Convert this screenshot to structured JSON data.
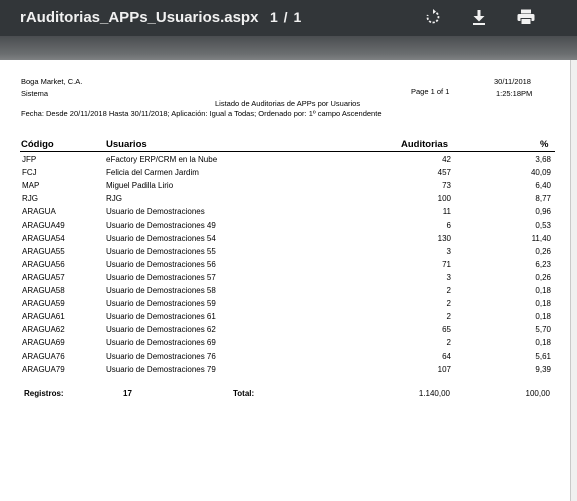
{
  "toolbar": {
    "title": "rAuditorias_APPs_Usuarios.aspx",
    "page_count": "1 / 1",
    "rotate_icon": "rotate-icon",
    "download_icon": "download-icon",
    "print_icon": "print-icon"
  },
  "report": {
    "company": "Boga Market, C.A.",
    "system": "Sistema",
    "page_label": "Page 1 of 1",
    "date": "30/11/2018",
    "time": "1:25:18PM",
    "title": "Listado de Auditorias de APPs por Usuarios",
    "filters": "Fecha: Desde 20/11/2018  Hasta 30/11/2018; Aplicación: Igual a Todas; Ordenado por: 1º campo Ascendente",
    "columns": {
      "code": "Código",
      "user": "Usuarios",
      "audits": "Auditorias",
      "pct": "%"
    },
    "rows": [
      {
        "code": "JFP",
        "user": "eFactory ERP/CRM en la Nube",
        "audits": "42",
        "pct": "3,68"
      },
      {
        "code": "FCJ",
        "user": "Felicia del Carmen Jardim",
        "audits": "457",
        "pct": "40,09"
      },
      {
        "code": "MAP",
        "user": "Miguel Padilla Lirio",
        "audits": "73",
        "pct": "6,40"
      },
      {
        "code": "RJG",
        "user": "RJG",
        "audits": "100",
        "pct": "8,77"
      },
      {
        "code": "ARAGUA",
        "user": "Usuario de Demostraciones",
        "audits": "11",
        "pct": "0,96"
      },
      {
        "code": "ARAGUA49",
        "user": "Usuario de Demostraciones 49",
        "audits": "6",
        "pct": "0,53"
      },
      {
        "code": "ARAGUA54",
        "user": "Usuario de Demostraciones 54",
        "audits": "130",
        "pct": "11,40"
      },
      {
        "code": "ARAGUA55",
        "user": "Usuario de Demostraciones 55",
        "audits": "3",
        "pct": "0,26"
      },
      {
        "code": "ARAGUA56",
        "user": "Usuario de Demostraciones 56",
        "audits": "71",
        "pct": "6,23"
      },
      {
        "code": "ARAGUA57",
        "user": "Usuario de Demostraciones 57",
        "audits": "3",
        "pct": "0,26"
      },
      {
        "code": "ARAGUA58",
        "user": "Usuario de Demostraciones 58",
        "audits": "2",
        "pct": "0,18"
      },
      {
        "code": "ARAGUA59",
        "user": "Usuario de Demostraciones 59",
        "audits": "2",
        "pct": "0,18"
      },
      {
        "code": "ARAGUA61",
        "user": "Usuario de Demostraciones 61",
        "audits": "2",
        "pct": "0,18"
      },
      {
        "code": "ARAGUA62",
        "user": "Usuario de Demostraciones 62",
        "audits": "65",
        "pct": "5,70"
      },
      {
        "code": "ARAGUA69",
        "user": "Usuario de Demostraciones 69",
        "audits": "2",
        "pct": "0,18"
      },
      {
        "code": "ARAGUA76",
        "user": "Usuario de Demostraciones 76",
        "audits": "64",
        "pct": "5,61"
      },
      {
        "code": "ARAGUA79",
        "user": "Usuario de Demostraciones 79",
        "audits": "107",
        "pct": "9,39"
      }
    ],
    "footer": {
      "records_label": "Registros:",
      "records_value": "17",
      "total_label": "Total:",
      "total_audits": "1.140,00",
      "total_pct": "100,00"
    }
  }
}
